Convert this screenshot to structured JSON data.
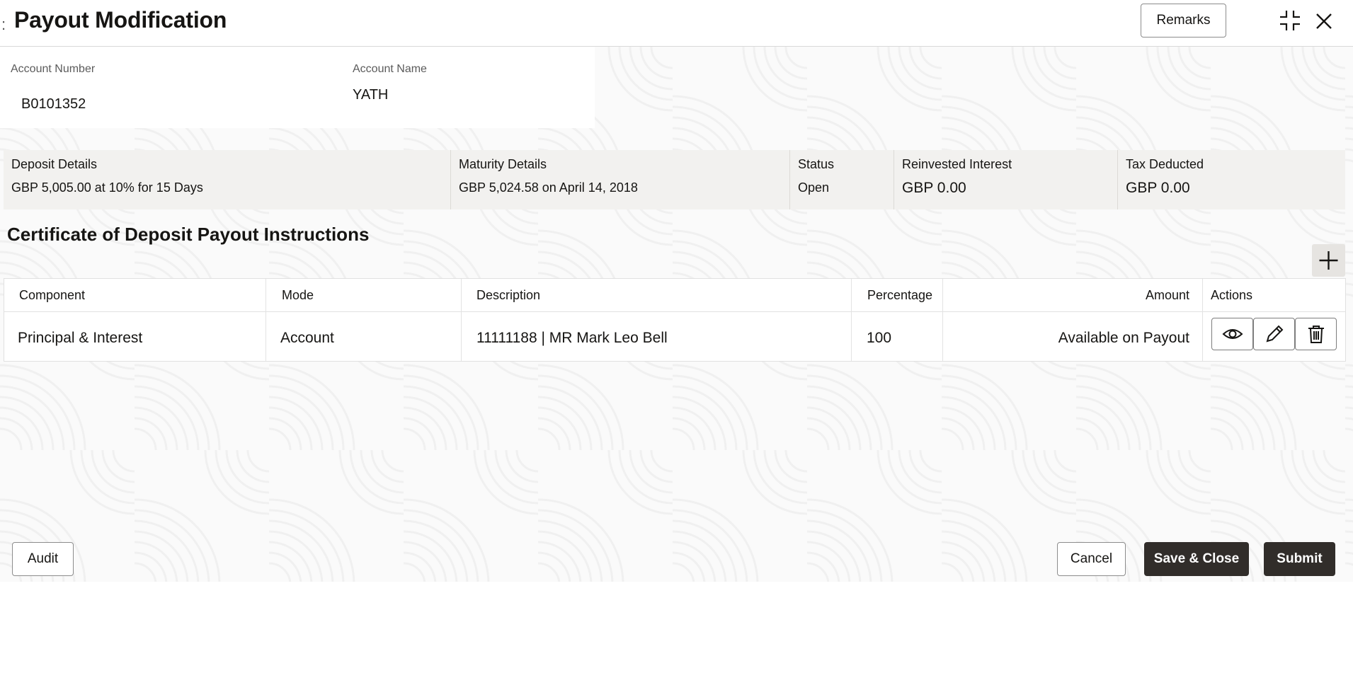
{
  "header": {
    "title": "Payout Modification",
    "remarks_label": "Remarks",
    "edge_mark": ":"
  },
  "account": {
    "number_label": "Account Number",
    "number_value": "B0101352",
    "name_label": "Account Name",
    "name_value": "YATH"
  },
  "summary": {
    "deposit_label": "Deposit Details",
    "deposit_value": "GBP 5,005.00 at 10% for 15 Days",
    "maturity_label": "Maturity Details",
    "maturity_value": "GBP 5,024.58 on April 14, 2018",
    "status_label": "Status",
    "status_value": "Open",
    "reinvested_label": "Reinvested Interest",
    "reinvested_value": "GBP 0.00",
    "tax_label": "Tax Deducted",
    "tax_value": "GBP 0.00"
  },
  "payout": {
    "section_title": "Certificate of Deposit Payout Instructions",
    "columns": {
      "component": "Component",
      "mode": "Mode",
      "description": "Description",
      "percentage": "Percentage",
      "amount": "Amount",
      "actions": "Actions"
    },
    "rows": [
      {
        "component": "Principal & Interest",
        "mode": "Account",
        "description": "11111188 | MR Mark Leo Bell",
        "percentage": "100",
        "amount": "Available on Payout"
      }
    ]
  },
  "footer": {
    "audit_label": "Audit",
    "cancel_label": "Cancel",
    "save_close_label": "Save & Close",
    "submit_label": "Submit"
  },
  "icons": {
    "minimize": "minimize-icon",
    "close": "close-icon",
    "add": "plus-icon",
    "view": "eye-icon",
    "edit": "pencil-icon",
    "delete": "trash-icon"
  },
  "colors": {
    "primary_button": "#312d2a",
    "summary_bg": "#f2f1ef"
  }
}
